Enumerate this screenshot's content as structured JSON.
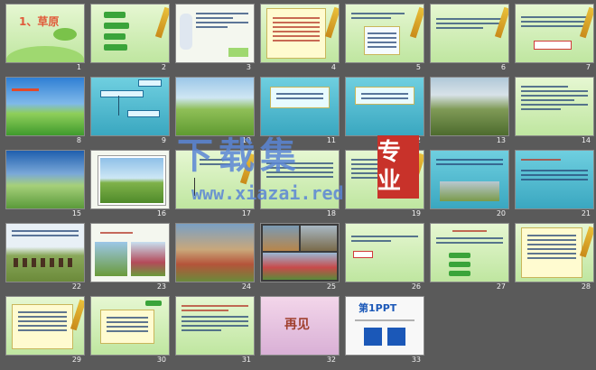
{
  "slides": [
    {
      "num": "1",
      "title": "1、草原"
    },
    {
      "num": "2"
    },
    {
      "num": "3"
    },
    {
      "num": "4"
    },
    {
      "num": "5"
    },
    {
      "num": "6"
    },
    {
      "num": "7"
    },
    {
      "num": "8"
    },
    {
      "num": "9"
    },
    {
      "num": "10"
    },
    {
      "num": "11"
    },
    {
      "num": "12"
    },
    {
      "num": "13"
    },
    {
      "num": "14"
    },
    {
      "num": "15"
    },
    {
      "num": "16"
    },
    {
      "num": "17"
    },
    {
      "num": "18"
    },
    {
      "num": "19"
    },
    {
      "num": "20"
    },
    {
      "num": "21"
    },
    {
      "num": "22"
    },
    {
      "num": "23"
    },
    {
      "num": "24"
    },
    {
      "num": "25"
    },
    {
      "num": "26"
    },
    {
      "num": "27"
    },
    {
      "num": "28"
    },
    {
      "num": "29"
    },
    {
      "num": "30"
    },
    {
      "num": "31"
    },
    {
      "num": "32",
      "title": "再见"
    },
    {
      "num": "33",
      "title": "第1PPT"
    }
  ],
  "watermark": {
    "text": "下载集",
    "url": "www.xiazai.red",
    "seal": "专业"
  }
}
